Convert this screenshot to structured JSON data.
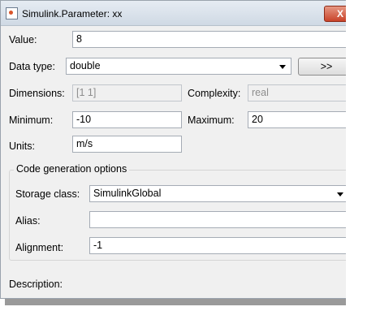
{
  "window": {
    "title": "Simulink.Parameter: xx",
    "close_label": "X"
  },
  "value": {
    "label": "Value:",
    "value": "8"
  },
  "data_type": {
    "label": "Data type:",
    "value": "double",
    "expand_button": ">>"
  },
  "dimensions": {
    "label": "Dimensions:",
    "value": "[1 1]"
  },
  "complexity": {
    "label": "Complexity:",
    "value": "real"
  },
  "minimum": {
    "label": "Minimum:",
    "value": "-10"
  },
  "maximum": {
    "label": "Maximum:",
    "value": "20"
  },
  "units": {
    "label": "Units:",
    "value": "m/s"
  },
  "code_gen": {
    "title": "Code generation options",
    "storage_class": {
      "label": "Storage class:",
      "value": "SimulinkGlobal"
    },
    "alias": {
      "label": "Alias:",
      "value": ""
    },
    "alignment": {
      "label": "Alignment:",
      "value": "-1"
    }
  },
  "description": {
    "label": "Description:"
  },
  "colors": {
    "close": "#c9432a",
    "window_bg": "#f0f0f0",
    "titlebar": "#d8e1ea"
  },
  "icons": {
    "app": "simulink-app-icon",
    "close": "close-icon",
    "dropdown": "chevron-down-icon"
  }
}
